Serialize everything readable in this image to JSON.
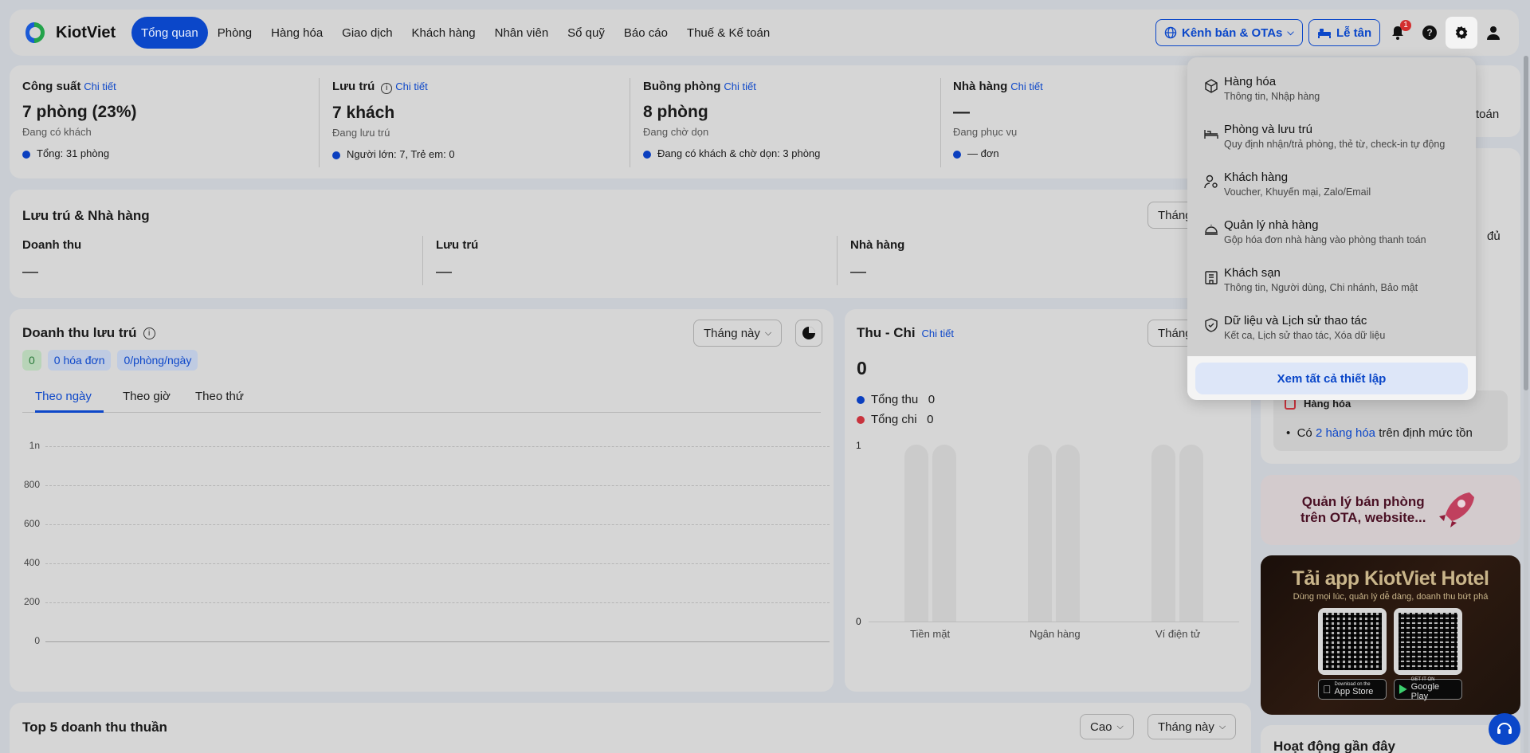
{
  "brand": {
    "name": "KiotViet",
    "accent": "#0b47c9"
  },
  "nav": {
    "items": [
      "Tổng quan",
      "Phòng",
      "Hàng hóa",
      "Giao dịch",
      "Khách hàng",
      "Nhân viên",
      "Sổ quỹ",
      "Báo cáo",
      "Thuế & Kế toán"
    ],
    "channels_label": "Kênh bán & OTAs",
    "reception_label": "Lễ tân",
    "notification_count": "1"
  },
  "stats": [
    {
      "title": "Công suất",
      "link": "Chi tiết",
      "value": "7 phòng (23%)",
      "sub": "Đang có khách",
      "foot": "Tổng: 31 phòng"
    },
    {
      "title": "Lưu trú",
      "link": "Chi tiết",
      "value": "7 khách",
      "sub": "Đang lưu trú",
      "foot": "Người lớn: 7, Trẻ em: 0"
    },
    {
      "title": "Buồng phòng",
      "link": "Chi tiết",
      "value": "8 phòng",
      "sub": "Đang chờ dọn",
      "foot": "Đang có khách & chờ dọn: 3 phòng"
    },
    {
      "title": "Nhà hàng",
      "link": "Chi tiết",
      "value": "—",
      "sub": "Đang phục vụ",
      "foot": "— đơn"
    }
  ],
  "stay_restaurant": {
    "title": "Lưu trú & Nhà hàng",
    "period": "Tháng",
    "cols": [
      {
        "label": "Doanh thu",
        "value": "—"
      },
      {
        "label": "Lưu trú",
        "value": "—"
      },
      {
        "label": "Nhà hàng",
        "value": "—"
      }
    ]
  },
  "stay_revenue": {
    "title": "Doanh thu lưu trú",
    "period": "Tháng này",
    "chip_count": "0",
    "chip_invoices": "0 hóa đơn",
    "chip_rate": "0/phòng/ngày",
    "tabs": [
      "Theo ngày",
      "Theo giờ",
      "Theo thứ"
    ]
  },
  "income_expense": {
    "title": "Thu - Chi",
    "link": "Chi tiết",
    "period": "Tháng",
    "total": "0",
    "legend": [
      {
        "label": "Tổng thu",
        "value": "0",
        "color": "#0b3fbf"
      },
      {
        "label": "Tổng chi",
        "value": "0",
        "color": "#c8333d"
      }
    ]
  },
  "chart_data": [
    {
      "type": "bar",
      "title": "",
      "categories": [],
      "values": [],
      "ylim": [
        0,
        1000
      ],
      "yticks": [
        "1n",
        "800",
        "600",
        "400",
        "200",
        "0"
      ],
      "grid": true
    },
    {
      "type": "bar",
      "title": "",
      "categories": [
        "Tiền mặt",
        "Ngân hàng",
        "Ví điện tử"
      ],
      "series": [
        {
          "name": "Tổng thu",
          "values": [
            0,
            0,
            0
          ]
        },
        {
          "name": "Tổng chi",
          "values": [
            0,
            0,
            0
          ]
        }
      ],
      "ylim": [
        0,
        1
      ],
      "yticks": [
        "1",
        "0"
      ]
    }
  ],
  "top5": {
    "title": "Top 5 doanh thu thuần",
    "sort": "Cao",
    "period": "Tháng này"
  },
  "right": {
    "partial_top": "toán",
    "partial_mid": "đủ",
    "goods_title": "Hàng hóa",
    "goods_pre": "Có",
    "goods_link": "2 hàng hóa",
    "goods_post": "trên định mức tồn",
    "promo_line1": "Quản lý bán phòng",
    "promo_line2": "trên OTA, website...",
    "app_title": "Tải app KiotViet Hotel",
    "app_sub": "Dùng mọi lúc, quản lý dễ dàng, doanh thu bứt phá",
    "appstore_small": "Download on the",
    "appstore": "App Store",
    "gplay_small": "GET IT ON",
    "gplay": "Google Play",
    "activity": "Hoạt động gần đây"
  },
  "settings_menu": {
    "items": [
      {
        "title": "Hàng hóa",
        "sub": "Thông tin, Nhập hàng",
        "icon": "box-icon"
      },
      {
        "title": "Phòng và lưu trú",
        "sub": "Quy định nhận/trả phòng, thẻ từ, check-in tự động",
        "icon": "bed-icon"
      },
      {
        "title": "Khách hàng",
        "sub": "Voucher, Khuyến mại, Zalo/Email",
        "icon": "user-settings-icon"
      },
      {
        "title": "Quản lý nhà hàng",
        "sub": "Gộp hóa đơn nhà hàng vào phòng thanh toán",
        "icon": "cloche-icon"
      },
      {
        "title": "Khách sạn",
        "sub": "Thông tin, Người dùng, Chi nhánh, Bảo mật",
        "icon": "hotel-icon"
      },
      {
        "title": "Dữ liệu và Lịch sử thao tác",
        "sub": "Kết ca, Lịch sử thao tác, Xóa dữ liệu",
        "icon": "shield-check-icon"
      }
    ],
    "view_all": "Xem tất cả thiết lập"
  }
}
